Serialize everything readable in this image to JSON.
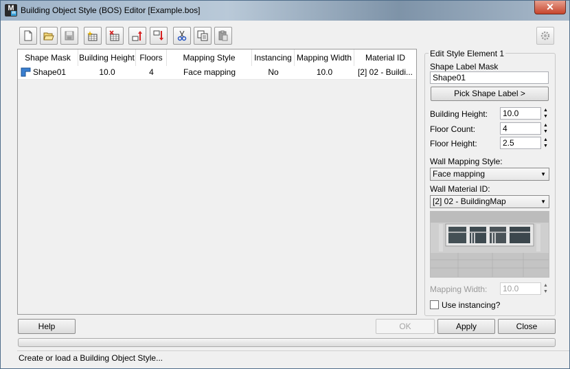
{
  "window": {
    "title": "Building Object Style (BOS) Editor [Example.bos]",
    "app_icon_text": "M",
    "app_icon_sub": "m",
    "close_label": "✕"
  },
  "grid": {
    "columns": [
      "Shape Mask",
      "Building Height",
      "Floors",
      "Mapping Style",
      "Instancing",
      "Mapping Width",
      "Material ID"
    ],
    "rows": [
      {
        "shape_mask": "Shape01",
        "building_height": "10.0",
        "floors": "4",
        "mapping_style": "Face mapping",
        "instancing": "No",
        "mapping_width": "10.0",
        "material_id": "[2] 02 - Buildi..."
      }
    ]
  },
  "style_element": {
    "group_title": "Edit Style Element 1",
    "shape_label_mask_label": "Shape Label Mask",
    "shape_label_mask_value": "Shape01",
    "pick_button": "Pick Shape Label  >",
    "building_height_label": "Building Height:",
    "building_height_value": "10.0",
    "floor_count_label": "Floor Count:",
    "floor_count_value": "4",
    "floor_height_label": "Floor Height:",
    "floor_height_value": "2.5",
    "wall_mapping_style_label": "Wall Mapping Style:",
    "wall_mapping_style_value": "Face mapping",
    "wall_material_label": "Wall Material ID:",
    "wall_material_value": "[2] 02 - BuildingMap",
    "mapping_width_label": "Mapping Width:",
    "mapping_width_value": "10.0",
    "use_instancing_label": "Use instancing?"
  },
  "buttons": {
    "help": "Help",
    "ok": "OK",
    "apply": "Apply",
    "close": "Close"
  },
  "status": {
    "text": "Create or load a Building Object Style..."
  },
  "colors": {
    "title_close": "#c7452c",
    "arrow_red": "#d62020",
    "shape_icon": "#3a7fd0"
  }
}
